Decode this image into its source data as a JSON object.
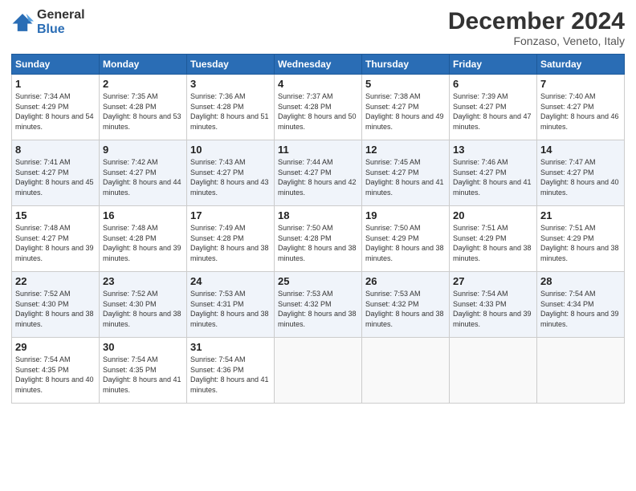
{
  "header": {
    "logo_general": "General",
    "logo_blue": "Blue",
    "month_title": "December 2024",
    "location": "Fonzaso, Veneto, Italy"
  },
  "weekdays": [
    "Sunday",
    "Monday",
    "Tuesday",
    "Wednesday",
    "Thursday",
    "Friday",
    "Saturday"
  ],
  "weeks": [
    [
      {
        "day": "1",
        "sunrise": "7:34 AM",
        "sunset": "4:29 PM",
        "daylight": "8 hours and 54 minutes."
      },
      {
        "day": "2",
        "sunrise": "7:35 AM",
        "sunset": "4:28 PM",
        "daylight": "8 hours and 53 minutes."
      },
      {
        "day": "3",
        "sunrise": "7:36 AM",
        "sunset": "4:28 PM",
        "daylight": "8 hours and 51 minutes."
      },
      {
        "day": "4",
        "sunrise": "7:37 AM",
        "sunset": "4:28 PM",
        "daylight": "8 hours and 50 minutes."
      },
      {
        "day": "5",
        "sunrise": "7:38 AM",
        "sunset": "4:27 PM",
        "daylight": "8 hours and 49 minutes."
      },
      {
        "day": "6",
        "sunrise": "7:39 AM",
        "sunset": "4:27 PM",
        "daylight": "8 hours and 47 minutes."
      },
      {
        "day": "7",
        "sunrise": "7:40 AM",
        "sunset": "4:27 PM",
        "daylight": "8 hours and 46 minutes."
      }
    ],
    [
      {
        "day": "8",
        "sunrise": "7:41 AM",
        "sunset": "4:27 PM",
        "daylight": "8 hours and 45 minutes."
      },
      {
        "day": "9",
        "sunrise": "7:42 AM",
        "sunset": "4:27 PM",
        "daylight": "8 hours and 44 minutes."
      },
      {
        "day": "10",
        "sunrise": "7:43 AM",
        "sunset": "4:27 PM",
        "daylight": "8 hours and 43 minutes."
      },
      {
        "day": "11",
        "sunrise": "7:44 AM",
        "sunset": "4:27 PM",
        "daylight": "8 hours and 42 minutes."
      },
      {
        "day": "12",
        "sunrise": "7:45 AM",
        "sunset": "4:27 PM",
        "daylight": "8 hours and 41 minutes."
      },
      {
        "day": "13",
        "sunrise": "7:46 AM",
        "sunset": "4:27 PM",
        "daylight": "8 hours and 41 minutes."
      },
      {
        "day": "14",
        "sunrise": "7:47 AM",
        "sunset": "4:27 PM",
        "daylight": "8 hours and 40 minutes."
      }
    ],
    [
      {
        "day": "15",
        "sunrise": "7:48 AM",
        "sunset": "4:27 PM",
        "daylight": "8 hours and 39 minutes."
      },
      {
        "day": "16",
        "sunrise": "7:48 AM",
        "sunset": "4:28 PM",
        "daylight": "8 hours and 39 minutes."
      },
      {
        "day": "17",
        "sunrise": "7:49 AM",
        "sunset": "4:28 PM",
        "daylight": "8 hours and 38 minutes."
      },
      {
        "day": "18",
        "sunrise": "7:50 AM",
        "sunset": "4:28 PM",
        "daylight": "8 hours and 38 minutes."
      },
      {
        "day": "19",
        "sunrise": "7:50 AM",
        "sunset": "4:29 PM",
        "daylight": "8 hours and 38 minutes."
      },
      {
        "day": "20",
        "sunrise": "7:51 AM",
        "sunset": "4:29 PM",
        "daylight": "8 hours and 38 minutes."
      },
      {
        "day": "21",
        "sunrise": "7:51 AM",
        "sunset": "4:29 PM",
        "daylight": "8 hours and 38 minutes."
      }
    ],
    [
      {
        "day": "22",
        "sunrise": "7:52 AM",
        "sunset": "4:30 PM",
        "daylight": "8 hours and 38 minutes."
      },
      {
        "day": "23",
        "sunrise": "7:52 AM",
        "sunset": "4:30 PM",
        "daylight": "8 hours and 38 minutes."
      },
      {
        "day": "24",
        "sunrise": "7:53 AM",
        "sunset": "4:31 PM",
        "daylight": "8 hours and 38 minutes."
      },
      {
        "day": "25",
        "sunrise": "7:53 AM",
        "sunset": "4:32 PM",
        "daylight": "8 hours and 38 minutes."
      },
      {
        "day": "26",
        "sunrise": "7:53 AM",
        "sunset": "4:32 PM",
        "daylight": "8 hours and 38 minutes."
      },
      {
        "day": "27",
        "sunrise": "7:54 AM",
        "sunset": "4:33 PM",
        "daylight": "8 hours and 39 minutes."
      },
      {
        "day": "28",
        "sunrise": "7:54 AM",
        "sunset": "4:34 PM",
        "daylight": "8 hours and 39 minutes."
      }
    ],
    [
      {
        "day": "29",
        "sunrise": "7:54 AM",
        "sunset": "4:35 PM",
        "daylight": "8 hours and 40 minutes."
      },
      {
        "day": "30",
        "sunrise": "7:54 AM",
        "sunset": "4:35 PM",
        "daylight": "8 hours and 41 minutes."
      },
      {
        "day": "31",
        "sunrise": "7:54 AM",
        "sunset": "4:36 PM",
        "daylight": "8 hours and 41 minutes."
      },
      null,
      null,
      null,
      null
    ]
  ]
}
